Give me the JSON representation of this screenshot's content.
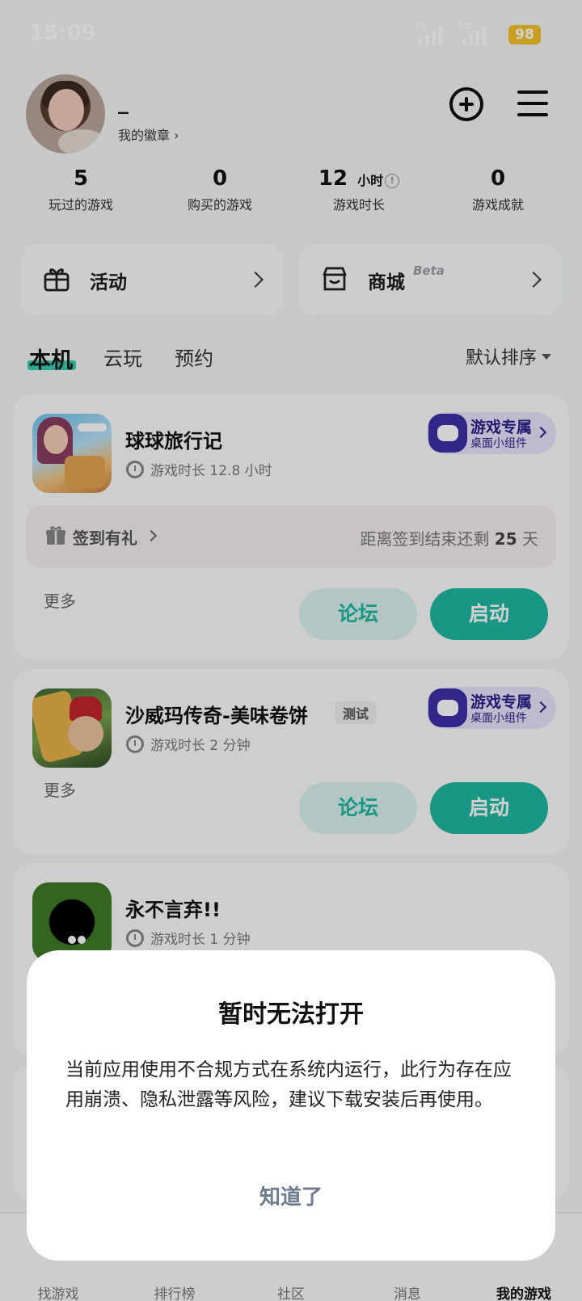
{
  "status_bar": {
    "time": "15:09",
    "signal1": "5G",
    "signal2": "5G",
    "battery": "98"
  },
  "profile": {
    "username": "_",
    "badge_link": "我的徽章 ›"
  },
  "stats": [
    {
      "value": "5",
      "unit": "",
      "label": "玩过的游戏"
    },
    {
      "value": "0",
      "unit": "",
      "label": "购买的游戏"
    },
    {
      "value": "12",
      "unit": "小时",
      "label": "游戏时长"
    },
    {
      "value": "0",
      "unit": "",
      "label": "游戏成就"
    }
  ],
  "shortcuts": [
    {
      "label": "活动",
      "icon": "gift-icon"
    },
    {
      "label": "商城",
      "badge": "Beta",
      "icon": "store-icon"
    }
  ],
  "tabs": [
    "本机",
    "云玩",
    "预约"
  ],
  "sort_label": "默认排序",
  "widget": {
    "line1": "游戏专属",
    "line2": "桌面小组件"
  },
  "games": [
    {
      "title": "球球旅行记",
      "tag": "",
      "playtime": "游戏时长 12.8 小时",
      "checkin_label": "签到有礼",
      "checkin_remain_prefix": "距离签到结束还剩",
      "checkin_remain_days": "25",
      "checkin_remain_suffix": "天",
      "more": "更多",
      "forum": "论坛",
      "launch": "启动"
    },
    {
      "title": "沙威玛传奇-美味卷饼",
      "tag": "测试",
      "playtime": "游戏时长 2 分钟",
      "more": "更多",
      "forum": "论坛",
      "launch": "启动"
    },
    {
      "title": "永不言弃!!",
      "tag": "",
      "playtime": "游戏时长 1 分钟"
    }
  ],
  "bottom_nav": [
    "找游戏",
    "排行榜",
    "社区",
    "消息",
    "我的游戏"
  ],
  "dialog": {
    "title": "暂时无法打开",
    "body": "当前应用使用不合规方式在系统内运行，此行为存在应用崩溃、隐私泄露等风险，建议下载安装后再使用。",
    "button": "知道了"
  },
  "colors": {
    "accent": "#1fb9a1",
    "accent_light": "#d9f2ee",
    "tab_highlight": "#35cdb3",
    "widget_bg": "#e7e4fb",
    "widget_fg": "#2a1f8a",
    "battery": "#f5c226"
  }
}
